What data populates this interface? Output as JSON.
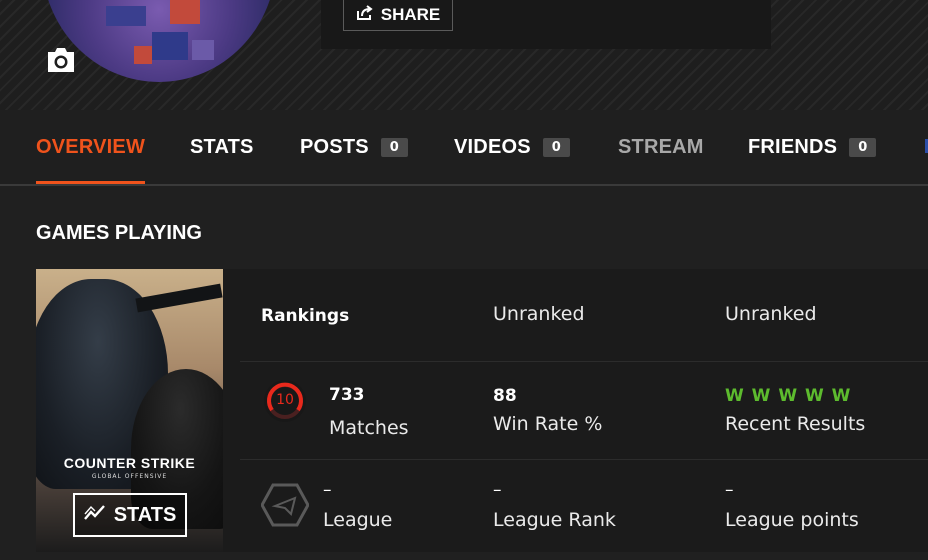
{
  "header": {
    "share_label": "SHARE",
    "camera_icon": "camera-icon",
    "share_icon": "share-icon"
  },
  "tabs": [
    {
      "label": "OVERVIEW",
      "active": true
    },
    {
      "label": "STATS"
    },
    {
      "label": "POSTS",
      "count": "0"
    },
    {
      "label": "VIDEOS",
      "count": "0"
    },
    {
      "label": "STREAM",
      "dim": true
    },
    {
      "label": "FRIENDS",
      "count": "0"
    }
  ],
  "section": {
    "title": "GAMES PLAYING"
  },
  "game": {
    "cover_logo": "COUNTER STRIKE",
    "cover_sub": "GLOBAL OFFENSIVE",
    "stats_button": "STATS",
    "rankings_label": "Rankings",
    "rank_1": "Unranked",
    "rank_2": "Unranked",
    "level": "10",
    "matches_value": "733",
    "matches_label": "Matches",
    "winrate_value": "88",
    "winrate_label": "Win Rate %",
    "recent_value": "W W W W W",
    "recent_label": "Recent Results",
    "league_value": "–",
    "league_label": "League",
    "league_rank_value": "–",
    "league_rank_label": "League Rank",
    "league_points_value": "–",
    "league_points_label": "League points"
  },
  "colors": {
    "accent": "#f0531c",
    "win": "#5dbb2e",
    "level_ring": "#e8291c"
  }
}
